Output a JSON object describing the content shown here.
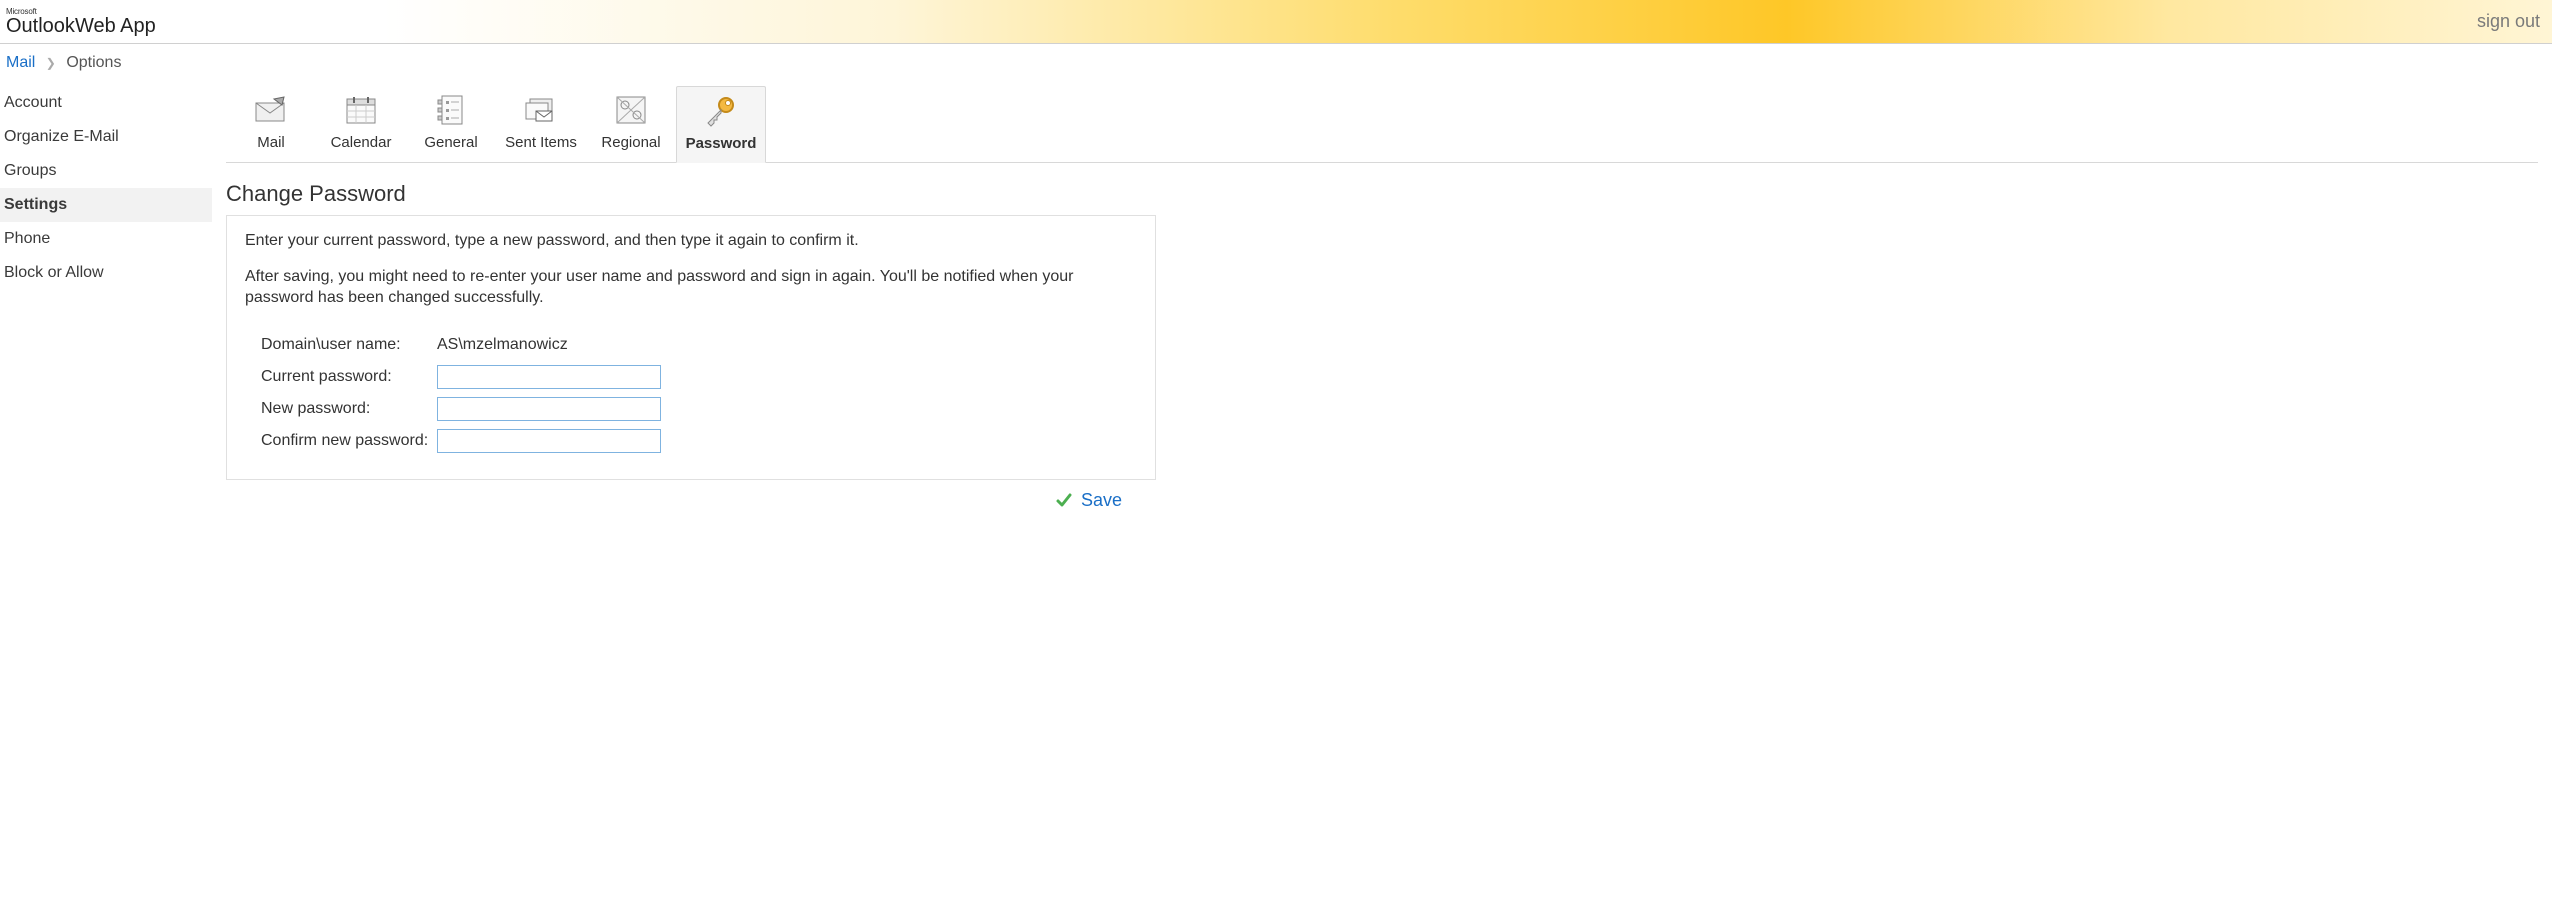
{
  "header": {
    "brand_ms": "Microsoft",
    "brand_app1": "Outlook",
    "brand_app2": "Web App",
    "signout": "sign out"
  },
  "breadcrumb": {
    "root": "Mail",
    "current": "Options"
  },
  "sidebar": {
    "items": [
      {
        "label": "Account",
        "active": false
      },
      {
        "label": "Organize E-Mail",
        "active": false
      },
      {
        "label": "Groups",
        "active": false
      },
      {
        "label": "Settings",
        "active": true
      },
      {
        "label": "Phone",
        "active": false
      },
      {
        "label": "Block or Allow",
        "active": false
      }
    ]
  },
  "tabs": {
    "items": [
      {
        "label": "Mail",
        "icon": "mail-icon",
        "active": false
      },
      {
        "label": "Calendar",
        "icon": "calendar-icon",
        "active": false
      },
      {
        "label": "General",
        "icon": "general-icon",
        "active": false
      },
      {
        "label": "Sent Items",
        "icon": "sent-items-icon",
        "active": false
      },
      {
        "label": "Regional",
        "icon": "regional-icon",
        "active": false
      },
      {
        "label": "Password",
        "icon": "password-icon",
        "active": true
      }
    ]
  },
  "page": {
    "title": "Change Password",
    "intro1": "Enter your current password, type a new password, and then type it again to confirm it.",
    "intro2": "After saving, you might need to re-enter your user name and password and sign in again. You'll be notified when your password has been changed successfully.",
    "form": {
      "domain_label": "Domain\\user name:",
      "domain_value": "AS\\mzelmanowicz",
      "current_label": "Current password:",
      "new_label": "New password:",
      "confirm_label": "Confirm new password:",
      "current_value": "",
      "new_value": "",
      "confirm_value": ""
    },
    "save_label": "Save"
  }
}
